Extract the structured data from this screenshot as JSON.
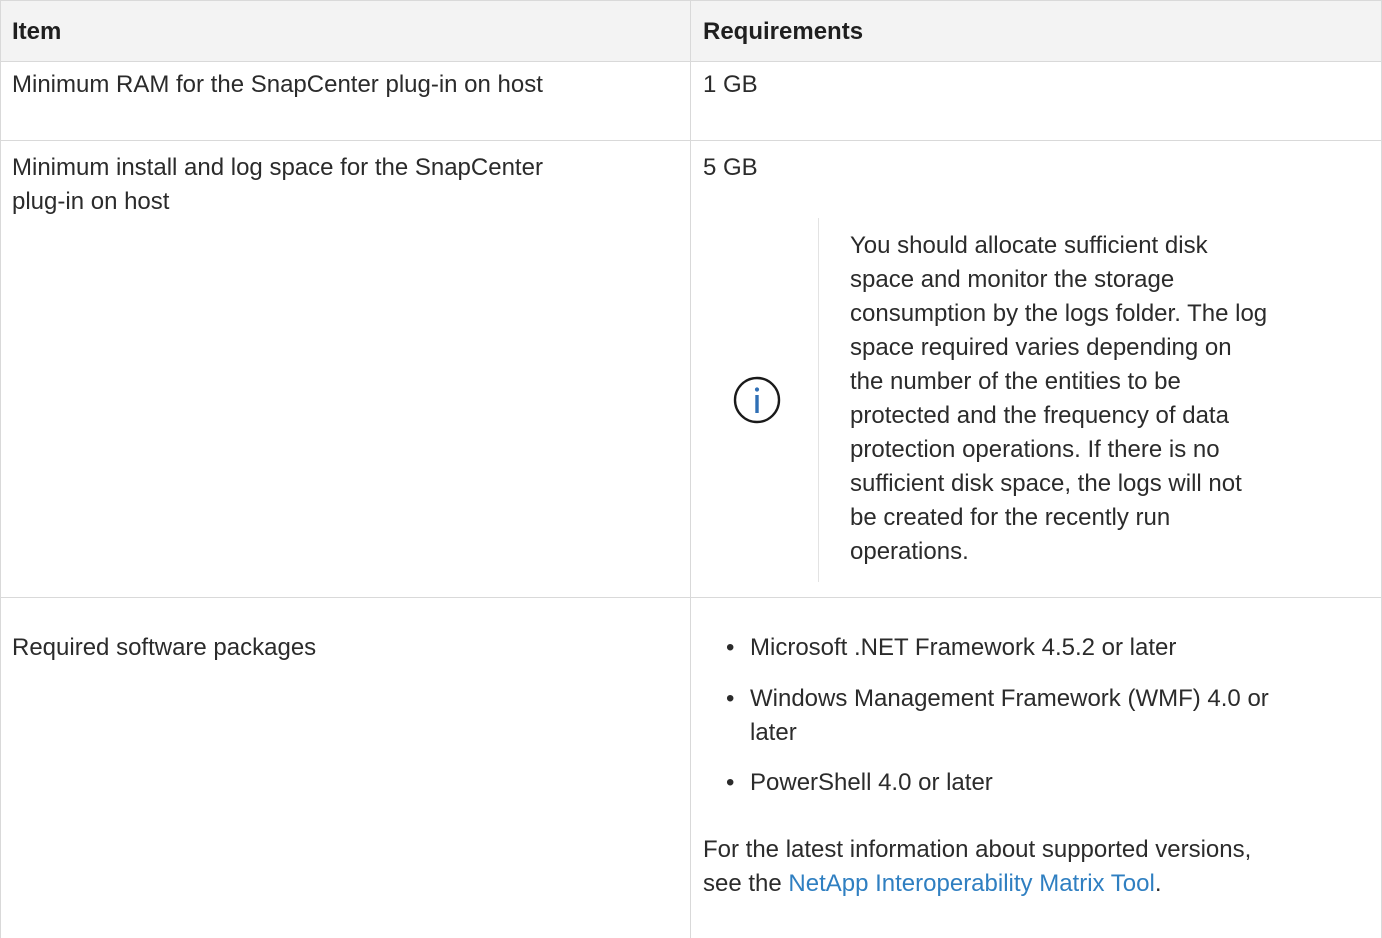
{
  "table": {
    "headers": {
      "item": "Item",
      "requirements": "Requirements"
    },
    "rows": [
      {
        "item": "Minimum RAM for the SnapCenter plug-in on host",
        "requirement": "1 GB"
      },
      {
        "item_line1": "Minimum install and log space for the SnapCenter",
        "item_line2": "plug-in on host",
        "requirement": "5 GB",
        "note": {
          "icon": "info-icon",
          "lines": [
            "You should allocate sufficient disk",
            "space and monitor the storage",
            "consumption by the logs folder. The log",
            "space required varies depending on",
            "the number of the entities to be",
            "protected and the frequency of data",
            "protection operations. If there is no",
            "sufficient disk space, the logs will not",
            "be created for the recently run",
            "operations."
          ]
        }
      },
      {
        "item": "Required software packages",
        "packages": [
          {
            "line1": "Microsoft .NET Framework 4.5.2 or later"
          },
          {
            "line1": "Windows Management Framework (WMF) 4.0 or",
            "line2": "later"
          },
          {
            "line1": "PowerShell 4.0 or later"
          }
        ],
        "footer_line1": "For the latest information about supported versions,",
        "footer_prefix": "see the ",
        "footer_link": "NetApp Interoperability Matrix Tool",
        "footer_suffix": "."
      }
    ]
  },
  "colors": {
    "link": "#2f7fc1",
    "icon": "#2f6fb5",
    "border": "#d9d9d9",
    "header_bg": "#f3f3f3"
  }
}
